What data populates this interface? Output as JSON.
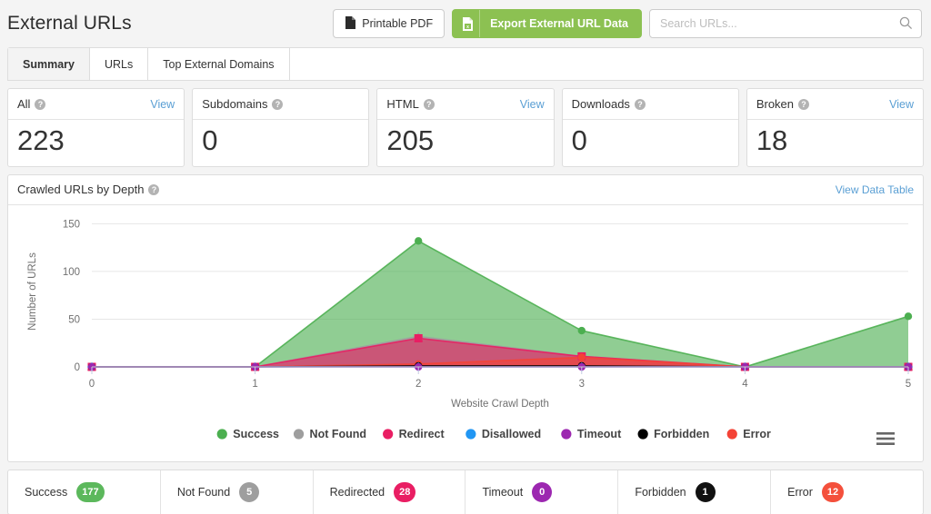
{
  "header": {
    "title": "External URLs",
    "printable_pdf_label": "Printable PDF",
    "export_label": "Export External URL Data",
    "search_placeholder": "Search URLs..."
  },
  "tabs": [
    {
      "label": "Summary",
      "active": true
    },
    {
      "label": "URLs",
      "active": false
    },
    {
      "label": "Top External Domains",
      "active": false
    }
  ],
  "cards": [
    {
      "label": "All",
      "value": "223",
      "view": "View"
    },
    {
      "label": "Subdomains",
      "value": "0",
      "view": ""
    },
    {
      "label": "HTML",
      "value": "205",
      "view": "View"
    },
    {
      "label": "Downloads",
      "value": "0",
      "view": ""
    },
    {
      "label": "Broken",
      "value": "18",
      "view": "View"
    }
  ],
  "chart_panel": {
    "title": "Crawled URLs by Depth",
    "data_table_link": "View Data Table",
    "menu_icon": "hamburger-menu-icon"
  },
  "chart_data": {
    "type": "area",
    "title": "Crawled URLs by Depth",
    "xlabel": "Website Crawl Depth",
    "ylabel": "Number of URLs",
    "x": [
      0,
      1,
      2,
      3,
      4,
      5
    ],
    "xtick_labels": [
      "0",
      "1",
      "2",
      "3",
      "4",
      "5"
    ],
    "ytick_labels": [
      "0",
      "50",
      "100",
      "150"
    ],
    "yticks": [
      0,
      50,
      100,
      150
    ],
    "ylim": [
      0,
      158
    ],
    "grid": true,
    "legend_position": "bottom",
    "series": [
      {
        "name": "Success",
        "color": "#4caf50",
        "values": [
          0,
          0,
          132,
          38,
          0,
          53
        ],
        "marker": "circle"
      },
      {
        "name": "Not Found",
        "color": "#9e9e9e",
        "values": [
          0,
          0,
          32,
          11,
          0,
          0
        ],
        "marker": "triangle"
      },
      {
        "name": "Redirect",
        "color": "#e91e63",
        "values": [
          0,
          0,
          30,
          11,
          0,
          0
        ],
        "marker": "square"
      },
      {
        "name": "Disallowed",
        "color": "#2196f3",
        "values": [
          0,
          0,
          0,
          0,
          0,
          0
        ],
        "marker": "diamond"
      },
      {
        "name": "Timeout",
        "color": "#9c27b0",
        "values": [
          0,
          0,
          0,
          0,
          0,
          0
        ],
        "marker": "circle"
      },
      {
        "name": "Forbidden",
        "color": "#000000",
        "values": [
          0,
          0,
          1,
          1,
          0,
          0
        ],
        "marker": "circle"
      },
      {
        "name": "Error",
        "color": "#f44336",
        "values": [
          0,
          0,
          3,
          10,
          0,
          0
        ],
        "marker": "circle"
      }
    ]
  },
  "status_summary": [
    {
      "label": "Success",
      "count": "177",
      "color": "#5cb85c"
    },
    {
      "label": "Not Found",
      "count": "5",
      "color": "#9e9e9e"
    },
    {
      "label": "Redirected",
      "count": "28",
      "color": "#e91e63"
    },
    {
      "label": "Timeout",
      "count": "0",
      "color": "#9c27b0"
    },
    {
      "label": "Forbidden",
      "count": "1",
      "color": "#111111"
    },
    {
      "label": "Error",
      "count": "12",
      "color": "#f4503c"
    }
  ]
}
